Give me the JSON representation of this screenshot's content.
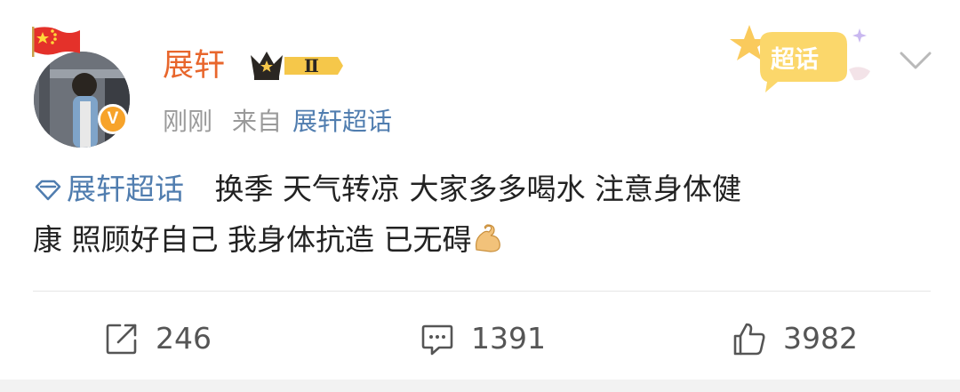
{
  "post": {
    "author": "展轩",
    "member_level": "Ⅱ",
    "verified_mark": "V",
    "time": "刚刚",
    "source_prefix": "来自",
    "source_link": "展轩超话",
    "badge_label": "超话",
    "topic": "展轩超话",
    "text_line1": "换季 天气转凉 大家多多喝水 注意身体健",
    "text_line2": "康 照顾好自己 我身体抗造 已无碍"
  },
  "actions": {
    "repost_count": "246",
    "comment_count": "1391",
    "like_count": "3982"
  },
  "icons": {
    "flag": "china-flag-icon",
    "crown": "crown-icon",
    "muscle": "flexed-biceps-emoji",
    "repost": "share-icon",
    "comment": "comment-icon",
    "like": "thumbs-up-icon",
    "more": "chevron-down-icon"
  },
  "colors": {
    "author": "#e8662c",
    "link": "#507daf",
    "muted": "#9a9a9a",
    "verified": "#f7a32a",
    "badge": "#f9c44a"
  }
}
